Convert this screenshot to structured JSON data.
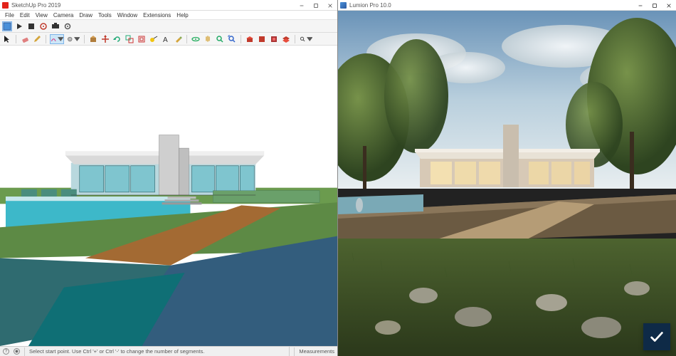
{
  "left": {
    "title": "SketchUp Pro 2019",
    "menu": [
      "File",
      "Edit",
      "View",
      "Camera",
      "Draw",
      "Tools",
      "Window",
      "Extensions",
      "Help"
    ],
    "toolbar1": [
      {
        "name": "template-icon",
        "sel": true
      },
      {
        "name": "play-icon"
      },
      {
        "name": "stop-icon"
      },
      {
        "name": "target-icon"
      },
      {
        "name": "camera-sync-icon"
      },
      {
        "name": "settings-icon"
      }
    ],
    "toolbar2": [
      {
        "name": "select-icon"
      },
      {
        "name": "eraser-icon"
      },
      {
        "name": "pencil-icon"
      },
      {
        "name": "arc-icon",
        "sel": true
      },
      {
        "name": "shape-icon"
      },
      {
        "name": "pushpull-icon"
      },
      {
        "name": "move-icon"
      },
      {
        "name": "rotate-icon"
      },
      {
        "name": "scale-icon"
      },
      {
        "name": "offset-icon"
      },
      {
        "name": "tape-icon"
      },
      {
        "name": "text-icon"
      },
      {
        "name": "paint-icon"
      },
      {
        "name": "orbit-icon"
      },
      {
        "name": "pan-icon"
      },
      {
        "name": "zoom-icon"
      },
      {
        "name": "zoom-extents-icon"
      },
      {
        "name": "warehouse-icon"
      },
      {
        "name": "component-icon"
      },
      {
        "name": "extension-icon"
      },
      {
        "name": "layers-icon"
      },
      {
        "name": "outliner-icon"
      }
    ],
    "status": {
      "hint": "Select start point. Use Ctrl '+' or Ctrl '-' to change the number of segments.",
      "measurements_label": "Measurements"
    }
  },
  "right": {
    "title": "Lumion Pro 10.0"
  }
}
